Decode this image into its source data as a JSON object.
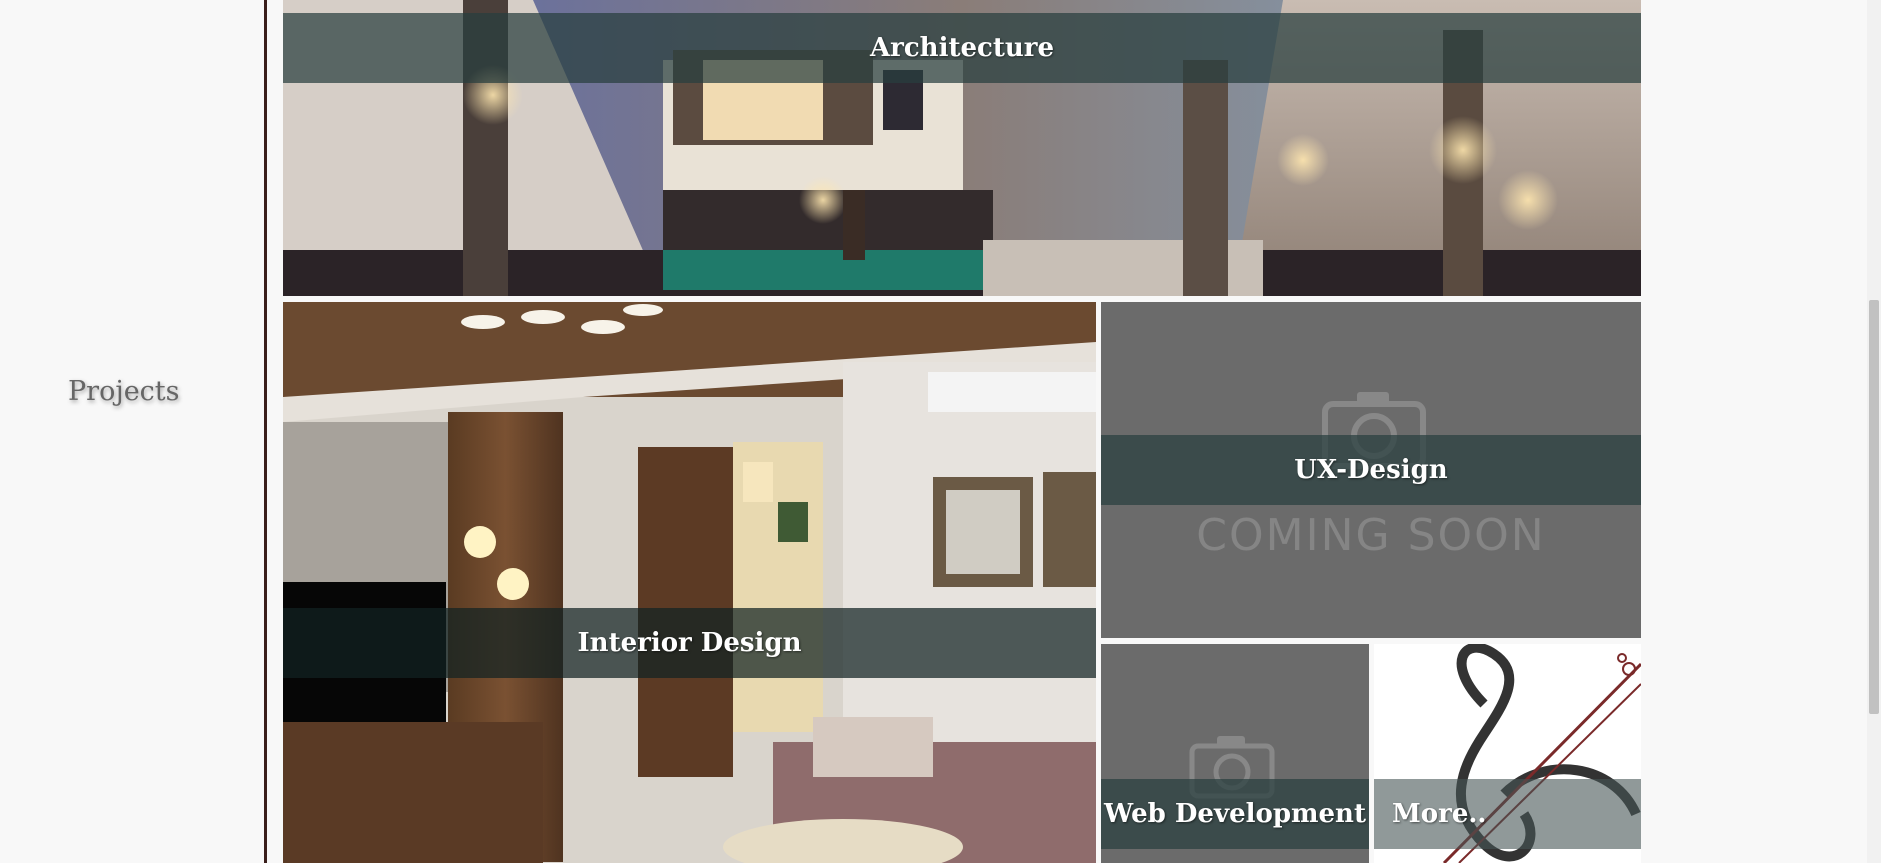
{
  "side_nav": {
    "label": "Projects"
  },
  "tiles": {
    "architecture": {
      "label": "Architecture"
    },
    "interior": {
      "label": "Interior Design"
    },
    "ux": {
      "label": "UX-Design",
      "placeholder_text": "COMING SOON"
    },
    "web": {
      "label": "Web Development"
    },
    "more": {
      "label": "More.."
    }
  },
  "colors": {
    "divider": "#3a1f1b",
    "label_band": "#283e3e",
    "placeholder_gray": "#6b6b6b"
  }
}
